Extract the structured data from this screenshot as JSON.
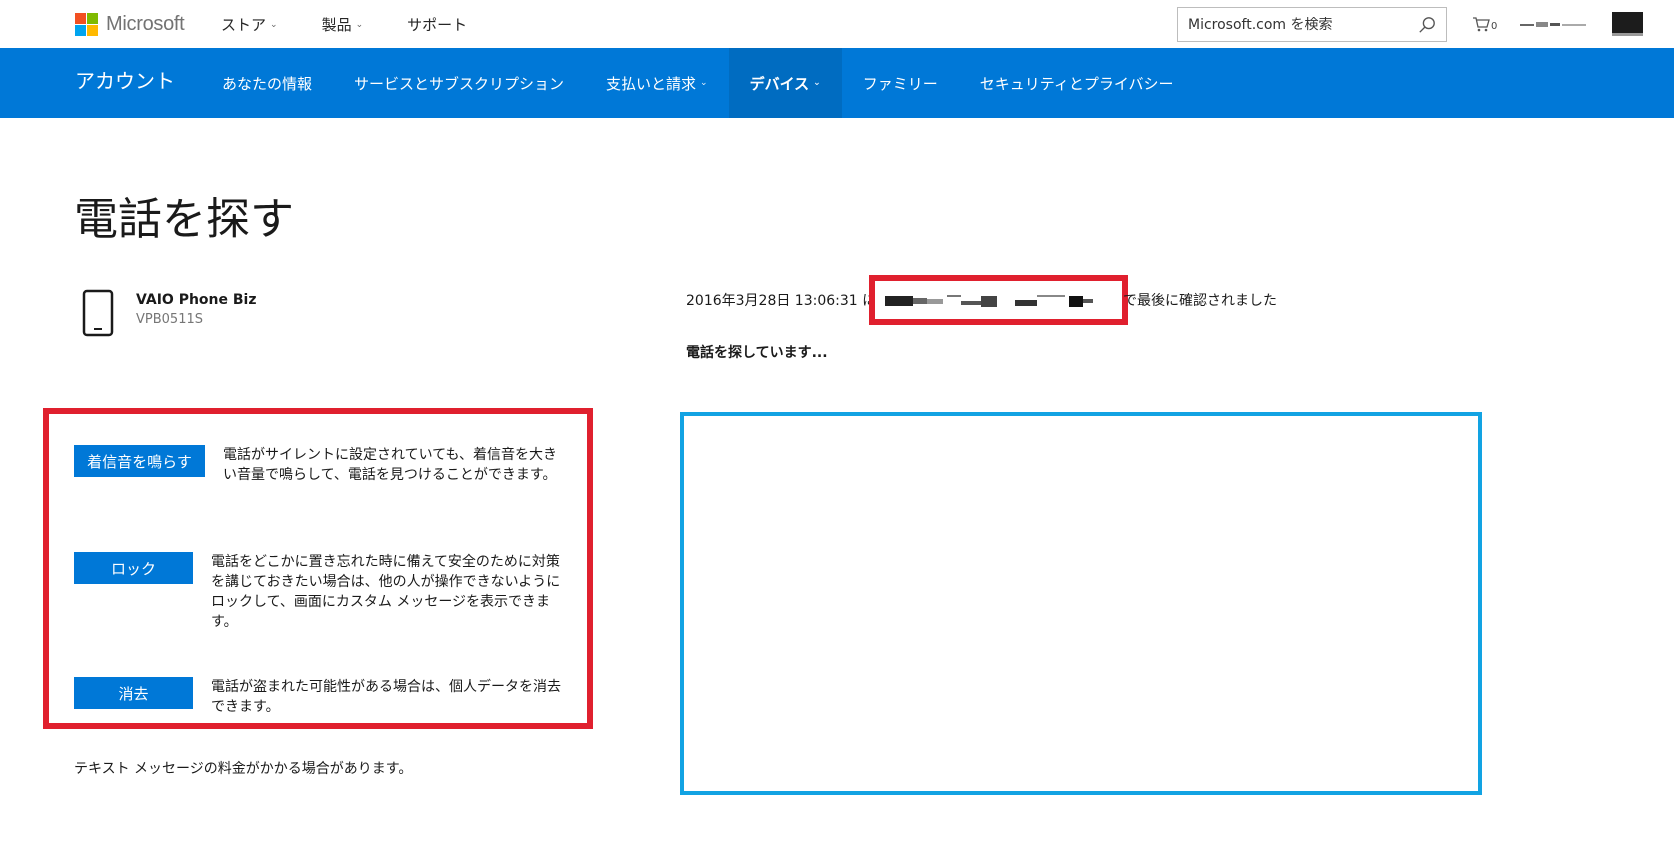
{
  "topbar": {
    "brand": "Microsoft",
    "nav": [
      {
        "label": "ストア",
        "has_dropdown": true
      },
      {
        "label": "製品",
        "has_dropdown": true
      },
      {
        "label": "サポート",
        "has_dropdown": false
      }
    ],
    "search_placeholder": "Microsoft.com を検索",
    "cart_count": "0",
    "logo_colors": [
      "#f25022",
      "#7fba00",
      "#00a4ef",
      "#ffb900"
    ]
  },
  "account_nav": {
    "title": "アカウント",
    "items": [
      {
        "label": "あなたの情報"
      },
      {
        "label": "サービスとサブスクリプション"
      },
      {
        "label": "支払いと請求"
      },
      {
        "label": "デバイス"
      },
      {
        "label": "ファミリー"
      },
      {
        "label": "セキュリティとプライバシー"
      }
    ],
    "active_item": "デバイス"
  },
  "page": {
    "title": "電話を探す",
    "device": {
      "name": "VAIO Phone Biz",
      "model": "VPB0511S"
    },
    "status_prefix": "2016年3月28日 13:06:31 に",
    "status_suffix": "で最後に確認されました",
    "searching": "電話を探しています..."
  },
  "actions": [
    {
      "button": "着信音を鳴らす",
      "description": "電話がサイレントに設定されていても、着信音を大きい音量で鳴らして、電話を見つけることができます。"
    },
    {
      "button": "ロック",
      "description": "電話をどこかに置き忘れた時に備えて安全のために対策を講じておきたい場合は、他の人が操作できないようにロックして、画面にカスタム メッセージを表示できます。"
    },
    {
      "button": "消去",
      "description": "電話が盗まれた可能性がある場合は、個人データを消去できます。"
    }
  ],
  "note": "テキスト メッセージの料金がかかる場合があります。",
  "colors": {
    "brand_blue": "#0078d7",
    "highlight_red": "#e0202e",
    "map_border": "#12a3e3"
  }
}
